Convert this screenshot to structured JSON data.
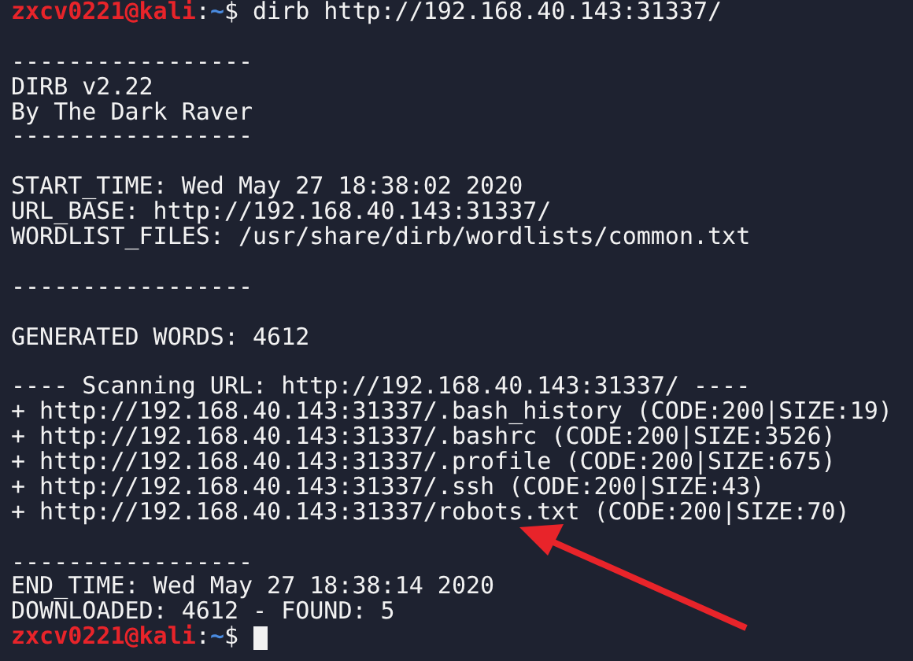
{
  "terminal": {
    "lines": [
      {
        "kind": "prompt",
        "user_host": "zxcv0221@kali",
        "separator": ":",
        "cwd": "~",
        "symbol": "$",
        "command": "dirb http://192.168.40.143:31337/",
        "cursor": false
      },
      {
        "kind": "blank"
      },
      {
        "kind": "text",
        "text": "-----------------"
      },
      {
        "kind": "text",
        "text": "DIRB v2.22"
      },
      {
        "kind": "text",
        "text": "By The Dark Raver"
      },
      {
        "kind": "text",
        "text": "-----------------"
      },
      {
        "kind": "blank"
      },
      {
        "kind": "text",
        "text": "START_TIME: Wed May 27 18:38:02 2020"
      },
      {
        "kind": "text",
        "text": "URL_BASE: http://192.168.40.143:31337/"
      },
      {
        "kind": "text",
        "text": "WORDLIST_FILES: /usr/share/dirb/wordlists/common.txt"
      },
      {
        "kind": "blank"
      },
      {
        "kind": "text",
        "text": "-----------------"
      },
      {
        "kind": "blank"
      },
      {
        "kind": "text",
        "text": "GENERATED WORDS: 4612"
      },
      {
        "kind": "blank"
      },
      {
        "kind": "text",
        "text": "---- Scanning URL: http://192.168.40.143:31337/ ----"
      },
      {
        "kind": "text",
        "text": "+ http://192.168.40.143:31337/.bash_history (CODE:200|SIZE:19)"
      },
      {
        "kind": "text",
        "text": "+ http://192.168.40.143:31337/.bashrc (CODE:200|SIZE:3526)"
      },
      {
        "kind": "text",
        "text": "+ http://192.168.40.143:31337/.profile (CODE:200|SIZE:675)"
      },
      {
        "kind": "text",
        "text": "+ http://192.168.40.143:31337/.ssh (CODE:200|SIZE:43)"
      },
      {
        "kind": "text",
        "text": "+ http://192.168.40.143:31337/robots.txt (CODE:200|SIZE:70)"
      },
      {
        "kind": "blank"
      },
      {
        "kind": "text",
        "text": "-----------------"
      },
      {
        "kind": "text",
        "text": "END_TIME: Wed May 27 18:38:14 2020"
      },
      {
        "kind": "text",
        "text": "DOWNLOADED: 4612 - FOUND: 5"
      },
      {
        "kind": "prompt",
        "user_host": "zxcv0221@kali",
        "separator": ":",
        "cwd": "~",
        "symbol": "$",
        "cursor": true
      }
    ]
  }
}
